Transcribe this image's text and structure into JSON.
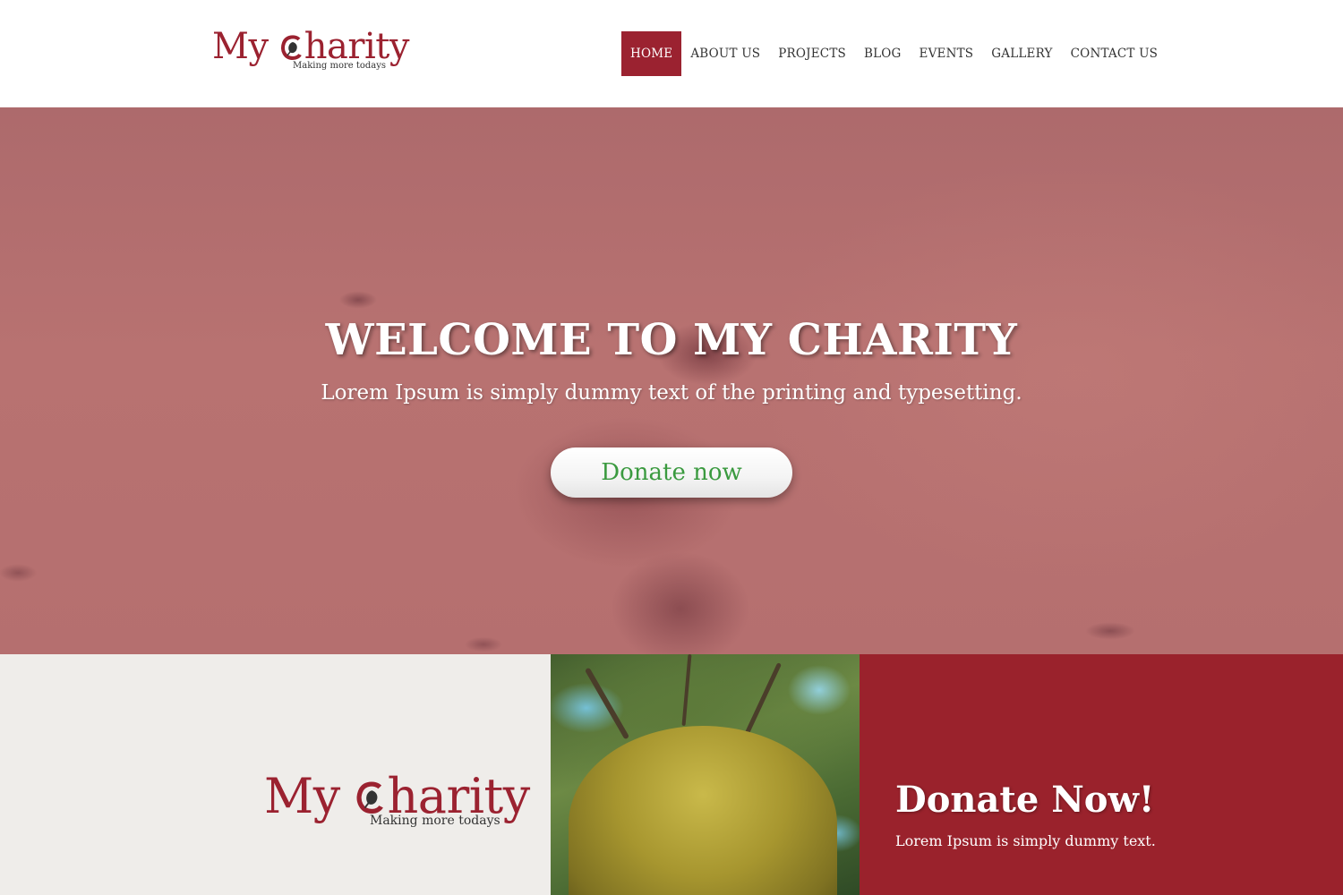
{
  "header": {
    "logo": {
      "text_before": "My ",
      "text_after": "harity",
      "tagline": "Making more todays"
    },
    "nav": [
      {
        "label": "HOME",
        "active": true
      },
      {
        "label": "ABOUT US",
        "active": false
      },
      {
        "label": "PROJECTS",
        "active": false
      },
      {
        "label": "BLOG",
        "active": false
      },
      {
        "label": "EVENTS",
        "active": false
      },
      {
        "label": "GALLERY",
        "active": false
      },
      {
        "label": "CONTACT US",
        "active": false
      }
    ]
  },
  "hero": {
    "title": "WELCOME TO MY CHARITY",
    "subtitle": "Lorem Ipsum is simply dummy text of the printing and typesetting.",
    "button_label": "Donate now"
  },
  "band": {
    "logo": {
      "text_before": "My ",
      "text_after": "harity",
      "tagline": "Making more todays"
    },
    "donate_title": "Donate Now!",
    "donate_text": "Lorem Ipsum is simply dummy text."
  },
  "colors": {
    "brand": "#9b2230",
    "button_text": "#3a9a3f",
    "band_bg": "#efedea"
  },
  "icons": [
    "leaf-c-icon"
  ]
}
